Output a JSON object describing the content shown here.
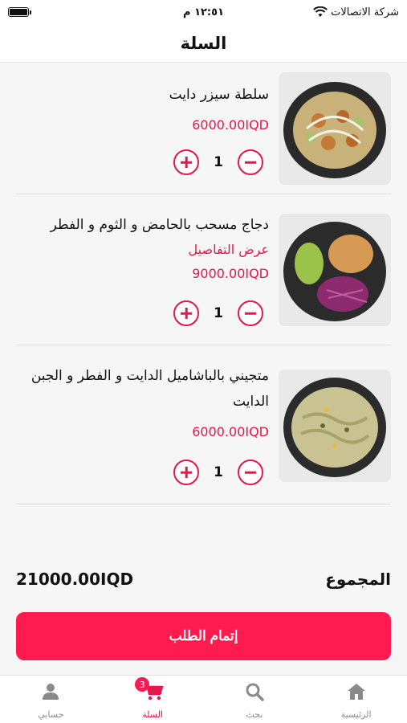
{
  "status_bar": {
    "time": "١٢:٥١ م",
    "carrier": "شركة الاتصالات"
  },
  "header": {
    "title": "السلة"
  },
  "cart": {
    "items": [
      {
        "name": "سلطة سيزر دايت",
        "details_link": "",
        "price": "6000.00IQD",
        "quantity": "1",
        "image_icon": "caesar-salad-photo"
      },
      {
        "name": "دجاج مسحب بالحامض و الثوم و الفطر",
        "details_link": "عرض التفاصيل",
        "price": "9000.00IQD",
        "quantity": "1",
        "image_icon": "chicken-salad-photo"
      },
      {
        "name": "متجيني بالباشاميل الدايت و الفطر و الجبن الدايت",
        "details_link": "",
        "price": "6000.00IQD",
        "quantity": "1",
        "image_icon": "pasta-bechamel-photo"
      }
    ]
  },
  "total": {
    "label": "المجموع",
    "value": "21000.00IQD"
  },
  "checkout": {
    "label": "إتمام الطلب"
  },
  "tab_bar": {
    "tabs": [
      {
        "label": "حسابي",
        "icon": "person-icon"
      },
      {
        "label": "السلة",
        "icon": "cart-icon",
        "badge": "3"
      },
      {
        "label": "بحث",
        "icon": "search-icon"
      },
      {
        "label": "الرئيسية",
        "icon": "home-icon"
      }
    ]
  },
  "colors": {
    "accent": "#ff1a4f",
    "price": "#e8164a",
    "background": "#f6f6f6"
  }
}
